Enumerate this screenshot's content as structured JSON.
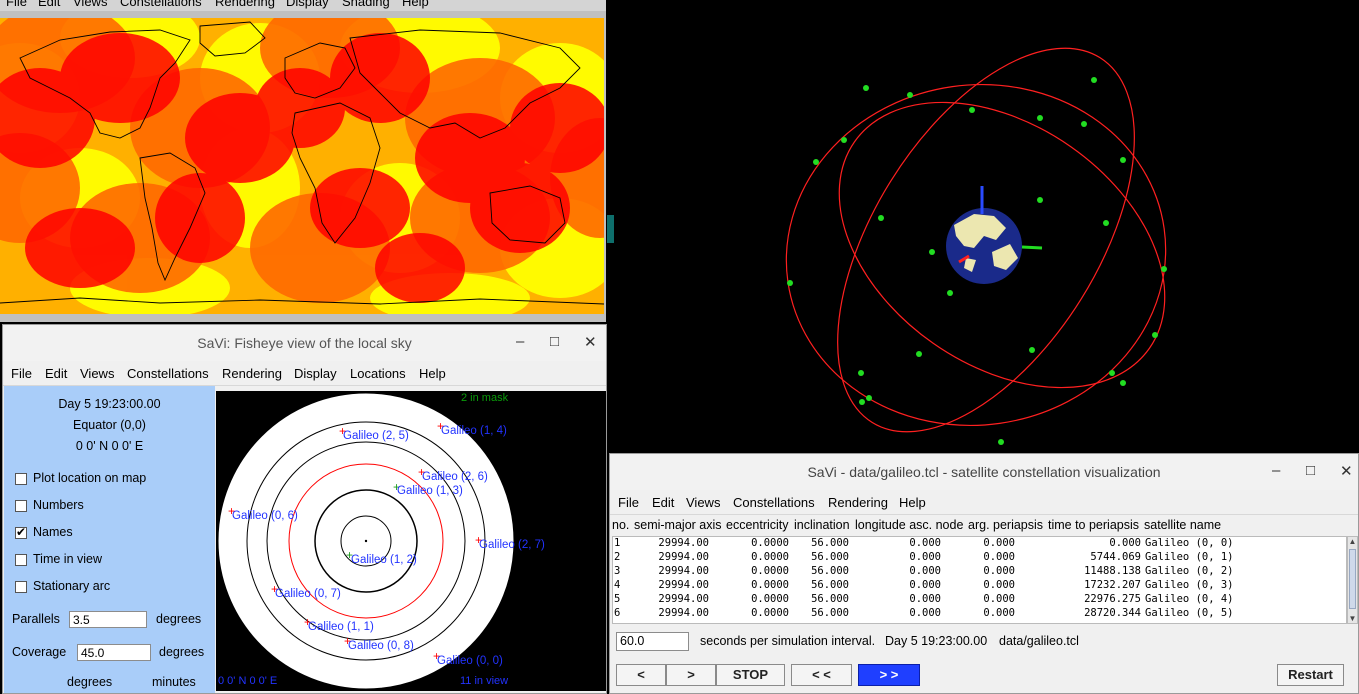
{
  "map_window": {
    "menu": [
      "File",
      "Edit",
      "Views",
      "Constellations",
      "Rendering",
      "Display",
      "Shading",
      "Help"
    ],
    "colors": {
      "land_fill": "#ff0000",
      "coverage_1": "#ff6a00",
      "coverage_2": "#ffff00",
      "background": "#ffb000"
    }
  },
  "fisheye_window": {
    "title": "SaVi: Fisheye view of the local sky",
    "controls": {
      "minimize": "–",
      "maximize": "□",
      "close": "✕"
    },
    "menu": [
      "File",
      "Edit",
      "Views",
      "Constellations",
      "Rendering",
      "Display",
      "Locations",
      "Help"
    ],
    "info": {
      "day_time": "Day 5  19:23:00.00",
      "location": "Equator (0,0)",
      "coords": "0  0' N 0  0' E"
    },
    "checkboxes": [
      {
        "label": "Plot location on map",
        "checked": false,
        "mark": ""
      },
      {
        "label": "Numbers",
        "checked": false,
        "mark": ""
      },
      {
        "label": "Names",
        "checked": true,
        "mark": "✔"
      },
      {
        "label": "Time in view",
        "checked": false,
        "mark": ""
      },
      {
        "label": "Stationary arc",
        "checked": false,
        "mark": ""
      }
    ],
    "parallels": {
      "label": "Parallels",
      "value": "3.5",
      "unit": "degrees"
    },
    "coverage": {
      "label": "Coverage",
      "value": "45.0",
      "unit": "degrees"
    },
    "bottom_labels": {
      "left": "degrees",
      "right": "minutes"
    },
    "sky": {
      "mask_text": "2 in mask",
      "in_view_text": "11 in view",
      "coords": "0  0' N 0  0' E",
      "satellites": [
        {
          "name": "Galileo (2, 5)"
        },
        {
          "name": "Galileo (1, 4)"
        },
        {
          "name": "Galileo (2, 6)"
        },
        {
          "name": "Galileo (1, 3)"
        },
        {
          "name": "Galileo (0, 6)"
        },
        {
          "name": "Galileo (2, 7)"
        },
        {
          "name": "Galileo (1, 2)"
        },
        {
          "name": "Galileo (0, 7)"
        },
        {
          "name": "Galileo (1, 1)"
        },
        {
          "name": "Galileo (0, 8)"
        },
        {
          "name": "Galileo (0, 0)"
        }
      ]
    }
  },
  "constellation_window": {
    "title": "SaVi - data/galileo.tcl - satellite constellation visualization",
    "controls": {
      "minimize": "–",
      "maximize": "□",
      "close": "✕"
    },
    "menu": [
      "File",
      "Edit",
      "Views",
      "Constellations",
      "Rendering",
      "Help"
    ],
    "columns": [
      "no.",
      "semi-major axis",
      "eccentricity",
      "inclination",
      "longitude asc. node",
      "arg. periapsis",
      "time to periapsis",
      "satellite name"
    ],
    "rows": [
      [
        "1",
        "29994.00",
        "0.0000",
        "56.000",
        "0.000",
        "0.000",
        "0.000",
        "Galileo (0, 0)"
      ],
      [
        "2",
        "29994.00",
        "0.0000",
        "56.000",
        "0.000",
        "0.000",
        "5744.069",
        "Galileo (0, 1)"
      ],
      [
        "3",
        "29994.00",
        "0.0000",
        "56.000",
        "0.000",
        "0.000",
        "11488.138",
        "Galileo (0, 2)"
      ],
      [
        "4",
        "29994.00",
        "0.0000",
        "56.000",
        "0.000",
        "0.000",
        "17232.207",
        "Galileo (0, 3)"
      ],
      [
        "5",
        "29994.00",
        "0.0000",
        "56.000",
        "0.000",
        "0.000",
        "22976.275",
        "Galileo (0, 4)"
      ],
      [
        "6",
        "29994.00",
        "0.0000",
        "56.000",
        "0.000",
        "0.000",
        "28720.344",
        "Galileo (0, 5)"
      ]
    ],
    "interval_value": "60.0",
    "interval_label": "seconds per simulation interval.",
    "day_time": "Day 5  19:23:00.00",
    "file": "data/galileo.tcl",
    "buttons": {
      "back": "<",
      "forward": ">",
      "stop": "STOP",
      "rewind": "< <",
      "fast_forward": "> >",
      "restart": "Restart"
    }
  },
  "view3d": {
    "colors": {
      "orbit": "#ff2020",
      "satellite": "#22dd22",
      "earth_ocean": "#1a2a8a",
      "earth_land": "#ece7b0"
    }
  }
}
